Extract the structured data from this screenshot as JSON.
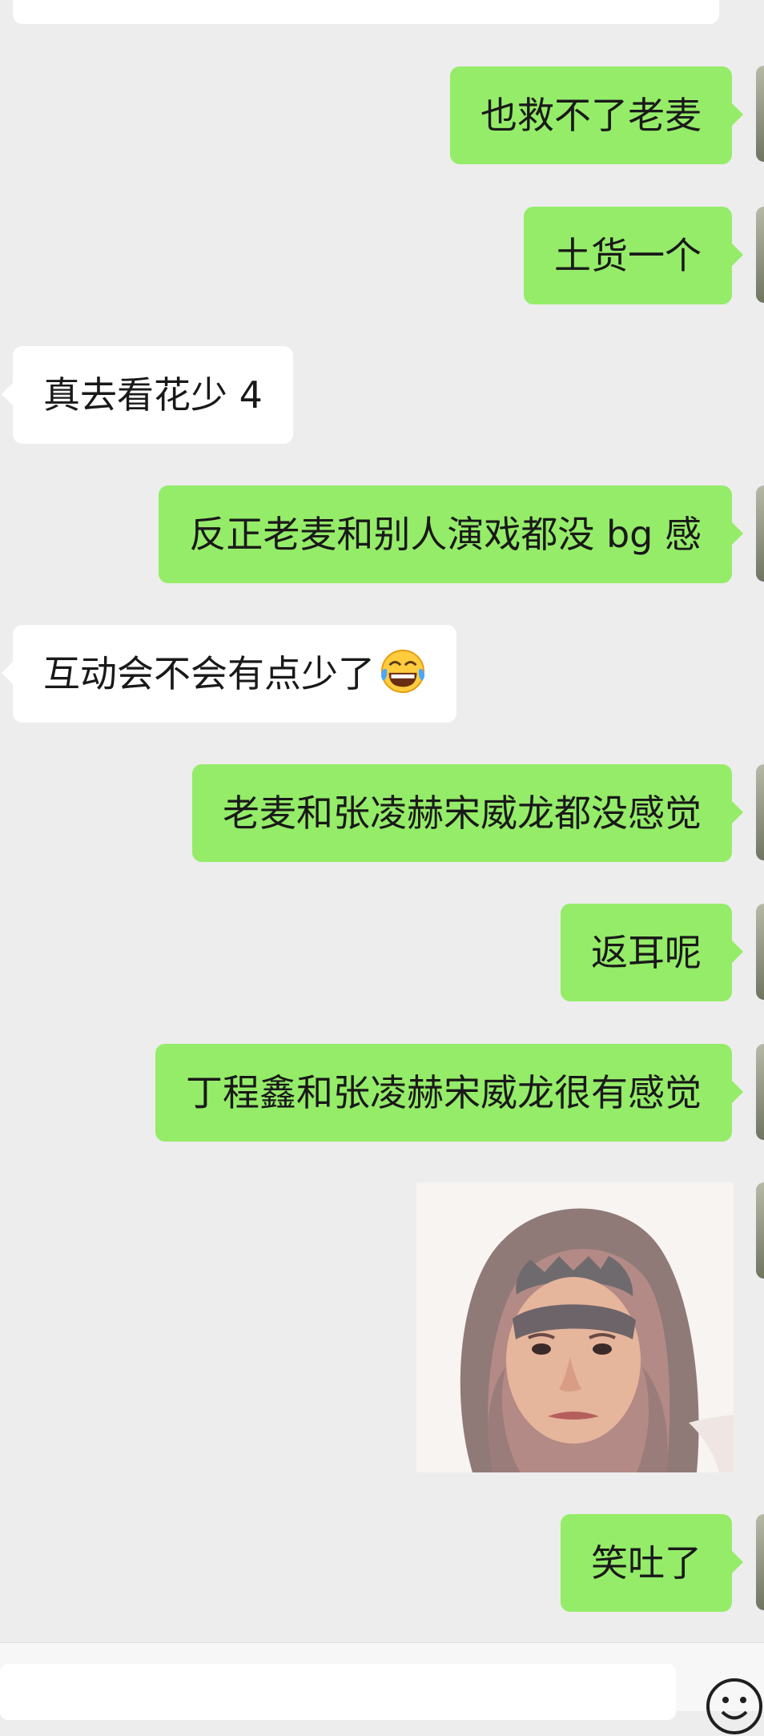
{
  "messages": [
    {
      "side": "out",
      "text": "也救不了老麦"
    },
    {
      "side": "out",
      "text": "土货一个"
    },
    {
      "side": "in",
      "text": "真去看花少 4"
    },
    {
      "side": "out",
      "text": "反正老麦和别人演戏都没 bg 感"
    },
    {
      "side": "in",
      "text": "互动会不会有点少了",
      "emoji": "tears-of-joy-emoji"
    },
    {
      "side": "out",
      "text": "老麦和张凌赫宋威龙都没感觉"
    },
    {
      "side": "out",
      "text": "返耳呢"
    },
    {
      "side": "out",
      "text": "丁程鑫和张凌赫宋威龙很有感觉"
    },
    {
      "side": "out",
      "type": "sticker",
      "image": "long-hair-face-photo"
    },
    {
      "side": "out",
      "text": "笑吐了"
    }
  ],
  "input_bar": {
    "emoji_button_icon": "smiley-face-icon"
  },
  "colors": {
    "background": "#ededed",
    "outgoing_bubble": "#95ec69",
    "incoming_bubble": "#ffffff",
    "text": "#191919"
  }
}
